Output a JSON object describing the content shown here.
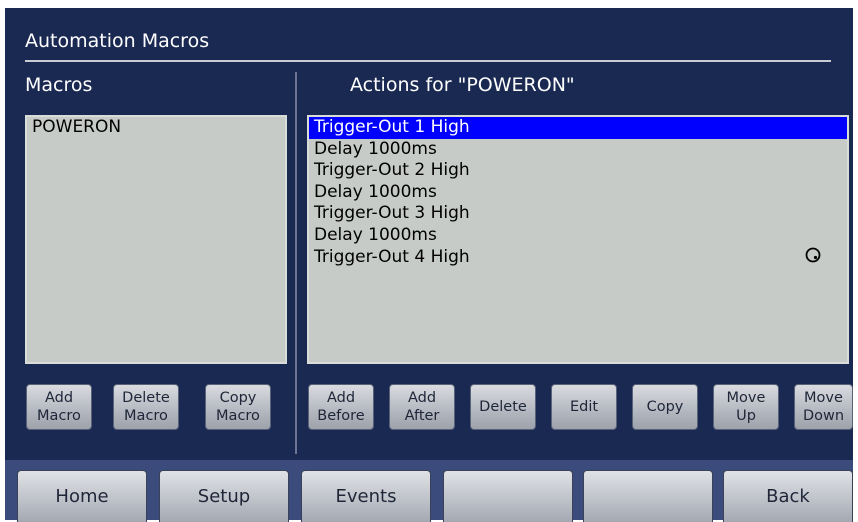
{
  "header": {
    "title": "Automation Macros"
  },
  "macros": {
    "label": "Macros",
    "items": [
      "POWERON"
    ],
    "buttons": {
      "add": "Add\nMacro",
      "delete": "Delete\nMacro",
      "copy": "Copy\nMacro"
    }
  },
  "actions": {
    "label": "Actions for \"POWERON\"",
    "items": [
      "Trigger-Out 1 High",
      "Delay 1000ms",
      "Trigger-Out 2 High",
      "Delay 1000ms",
      "Trigger-Out 3 High",
      "Delay 1000ms",
      "Trigger-Out 4 High"
    ],
    "selected_index": 0,
    "buttons": {
      "add_before": "Add\nBefore",
      "add_after": "Add\nAfter",
      "delete": "Delete",
      "edit": "Edit",
      "copy": "Copy",
      "move_up": "Move\nUp",
      "move_down": "Move\nDown"
    }
  },
  "nav": {
    "home": "Home",
    "setup": "Setup",
    "events": "Events",
    "blank1": "",
    "blank2": "",
    "back": "Back"
  },
  "icons": {
    "cursor": "cursor-circle-icon"
  },
  "colors": {
    "background": "#1a2952",
    "selection": "#0000ff",
    "list_bg": "#c7cbc8"
  }
}
